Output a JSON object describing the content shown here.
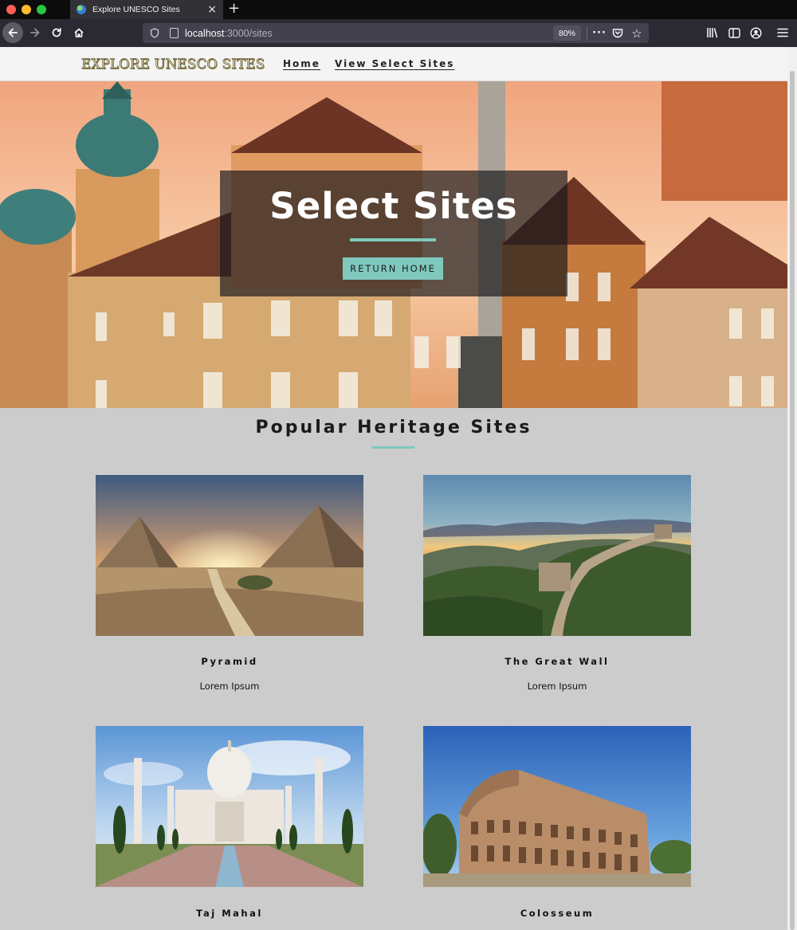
{
  "browser": {
    "tab_title": "Explore UNESCO Sites",
    "url_host": "localhost",
    "url_path": ":3000/sites",
    "zoom": "80%"
  },
  "site": {
    "logo": "EXPLORE UNESCO SITES",
    "nav": [
      "Home",
      "View Select Sites"
    ]
  },
  "hero": {
    "title": "Select Sites",
    "button": "RETURN HOME"
  },
  "section": {
    "title": "Popular Heritage Sites"
  },
  "cards": [
    {
      "title": "Pyramid",
      "desc": "Lorem Ipsum"
    },
    {
      "title": "The Great Wall",
      "desc": "Lorem Ipsum"
    },
    {
      "title": "Taj Mahal"
    },
    {
      "title": "Colosseum"
    }
  ],
  "colors": {
    "accent": "#7fc8bd",
    "page_bg": "#cccccc"
  }
}
